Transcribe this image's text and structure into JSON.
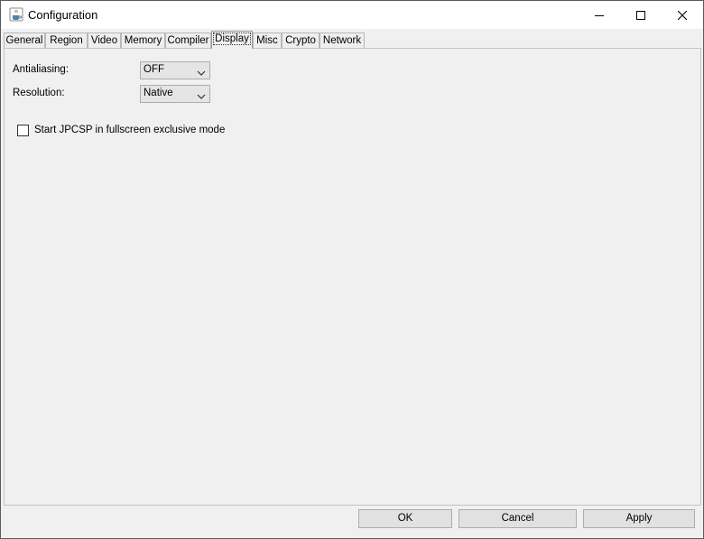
{
  "window": {
    "title": "Configuration",
    "app_icon": "java-cup-icon",
    "controls": {
      "minimize_icon": "minimize-icon",
      "maximize_icon": "maximize-icon",
      "close_icon": "close-icon"
    }
  },
  "tabs": [
    {
      "label": "General"
    },
    {
      "label": "Region"
    },
    {
      "label": "Video"
    },
    {
      "label": "Memory"
    },
    {
      "label": "Compiler"
    },
    {
      "label": "Display",
      "selected": true
    },
    {
      "label": "Misc"
    },
    {
      "label": "Crypto"
    },
    {
      "label": "Network"
    }
  ],
  "display": {
    "antialiasing": {
      "label": "Antialiasing:",
      "value": "OFF"
    },
    "resolution": {
      "label": "Resolution:",
      "value": "Native"
    },
    "fullscreen": {
      "label": "Start JPCSP in fullscreen exclusive mode",
      "checked": false
    }
  },
  "buttons": {
    "ok": "OK",
    "cancel": "Cancel",
    "apply": "Apply"
  },
  "colors": {
    "window_bg": "#f0f0f0",
    "titlebar_bg": "#ffffff",
    "button_bg": "#e1e1e1",
    "combo_bg": "#e5e5e5"
  }
}
